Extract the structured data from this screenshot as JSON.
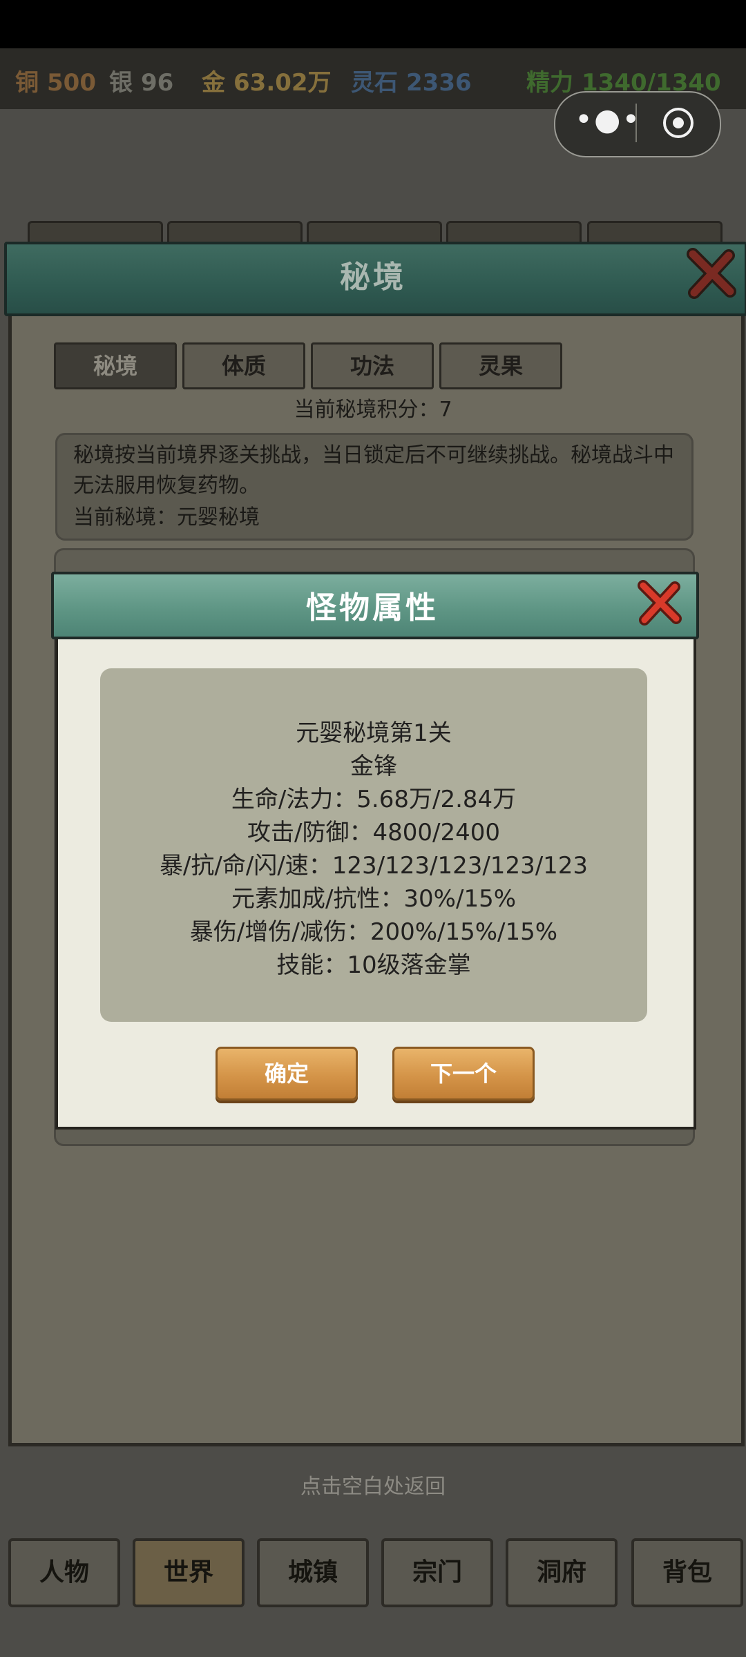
{
  "resources": {
    "copper": {
      "label": "铜",
      "value": "500"
    },
    "silver": {
      "label": "银",
      "value": "96"
    },
    "gold": {
      "label": "金",
      "value": "63.02万"
    },
    "spirit_stone": {
      "label": "灵石",
      "value": "2336"
    },
    "energy": {
      "label": "精力",
      "value": "1340/1340"
    }
  },
  "capsule": {
    "menu_icon": "more-dots-icon",
    "close_icon": "target-circle-icon"
  },
  "panel": {
    "title": "秘境",
    "tabs": [
      "秘境",
      "体质",
      "功法",
      "灵果"
    ],
    "active_tab": "秘境",
    "score": "当前秘境积分：7",
    "desc": "秘境按当前境界逐关挑战，当日锁定后不可继续挑战。秘境战斗中无法服用恢复药物。",
    "current": "当前秘境：元婴秘境"
  },
  "dialog": {
    "title": "怪物属性",
    "lines": [
      "元婴秘境第1关",
      "金锋",
      "生命/法力：5.68万/2.84万",
      "攻击/防御：4800/2400",
      "暴/抗/命/闪/速：123/123/123/123/123",
      "元素加成/抗性：30%/15%",
      "暴伤/增伤/减伤：200%/15%/15%",
      "技能：10级落金掌"
    ],
    "confirm_label": "确定",
    "next_label": "下一个"
  },
  "hint": "点击空白处返回",
  "nav": [
    "人物",
    "世界",
    "城镇",
    "宗门",
    "洞府",
    "背包"
  ],
  "nav_active": "世界",
  "colors": {
    "copper": "#7a5a36",
    "silver": "#6e6e66",
    "gold": "#86703c",
    "spirit_stone": "#3d5774",
    "energy": "#3f6a2e"
  }
}
